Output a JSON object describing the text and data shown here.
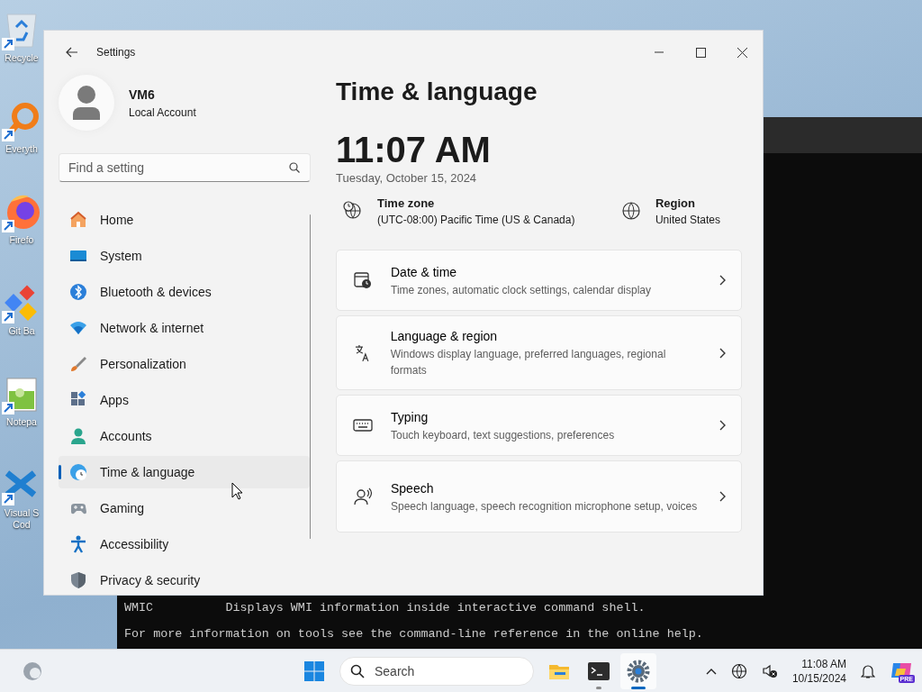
{
  "desktop_icons": [
    {
      "kind": "recycle",
      "lines": [
        "Recycle"
      ]
    },
    {
      "kind": "everything",
      "lines": [
        "Everyth"
      ]
    },
    {
      "kind": "firefox",
      "lines": [
        "Firefo"
      ]
    },
    {
      "kind": "gitbash",
      "lines": [
        "Git Ba"
      ]
    },
    {
      "kind": "notepad",
      "lines": [
        "Notepa"
      ]
    },
    {
      "kind": "vscode",
      "lines": [
        "Visual S",
        "Cod"
      ]
    }
  ],
  "terminal": {
    "lines": [
      "WMIC          Displays WMI information inside interactive command shell.",
      "For more information on tools see the command-line reference in the online help."
    ]
  },
  "settings": {
    "title": "Settings",
    "account": {
      "name": "VM6",
      "type": "Local Account"
    },
    "search": {
      "placeholder": "Find a setting"
    },
    "nav": [
      {
        "kind": "home",
        "label": "Home",
        "selected": false
      },
      {
        "kind": "system",
        "label": "System",
        "selected": false
      },
      {
        "kind": "bluetooth",
        "label": "Bluetooth & devices",
        "selected": false
      },
      {
        "kind": "network",
        "label": "Network & internet",
        "selected": false
      },
      {
        "kind": "personalization",
        "label": "Personalization",
        "selected": false
      },
      {
        "kind": "apps",
        "label": "Apps",
        "selected": false
      },
      {
        "kind": "accounts",
        "label": "Accounts",
        "selected": false
      },
      {
        "kind": "time",
        "label": "Time & language",
        "selected": true
      },
      {
        "kind": "gaming",
        "label": "Gaming",
        "selected": false
      },
      {
        "kind": "accessibility",
        "label": "Accessibility",
        "selected": false
      },
      {
        "kind": "privacy",
        "label": "Privacy & security",
        "selected": false
      }
    ],
    "page_title": "Time & language",
    "time": "11:07 AM",
    "date": "Tuesday, October 15, 2024",
    "info": [
      {
        "kind": "timezone",
        "label": "Time zone",
        "value": "(UTC-08:00) Pacific Time (US & Canada)"
      },
      {
        "kind": "region",
        "label": "Region",
        "value": "United States"
      }
    ],
    "cards": [
      {
        "kind": "datetime",
        "title": "Date & time",
        "description": "Time zones, automatic clock settings, calendar display"
      },
      {
        "kind": "language",
        "title": "Language & region",
        "description": "Windows display language, preferred languages, regional formats"
      },
      {
        "kind": "typing",
        "title": "Typing",
        "description": "Touch keyboard, text suggestions, preferences"
      },
      {
        "kind": "speech",
        "title": "Speech",
        "description": "Speech language, speech recognition microphone setup, voices"
      }
    ]
  },
  "taskbar": {
    "search": {
      "placeholder": "Search"
    },
    "apps": [
      {
        "kind": "explorer",
        "running": false,
        "selected": false
      },
      {
        "kind": "terminal",
        "running": true,
        "selected": false
      },
      {
        "kind": "settings",
        "running": true,
        "selected": true
      }
    ],
    "time": "11:08 AM",
    "date": "10/15/2024",
    "copilot_badge": "PRE"
  }
}
